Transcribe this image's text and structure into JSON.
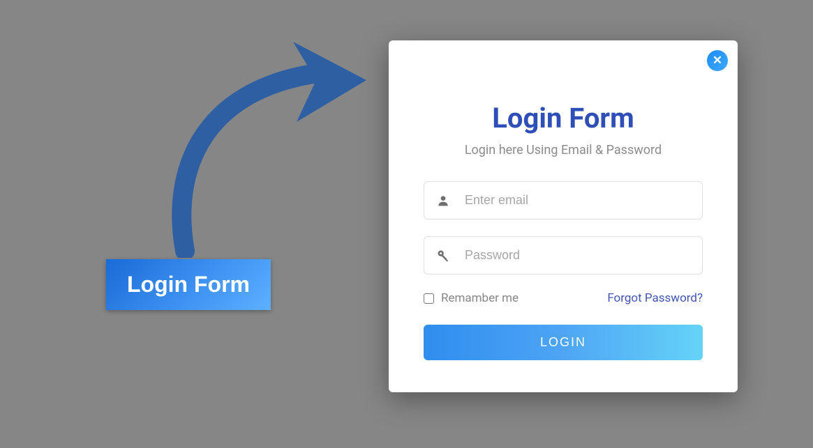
{
  "trigger": {
    "label": "Login Form"
  },
  "modal": {
    "title": "Login Form",
    "subtitle": "Login here Using Email & Password",
    "email_placeholder": "Enter email",
    "password_placeholder": "Password",
    "remember_label": "Remamber me",
    "forgot_label": "Forgot Password?",
    "login_button": "LOGIN"
  }
}
